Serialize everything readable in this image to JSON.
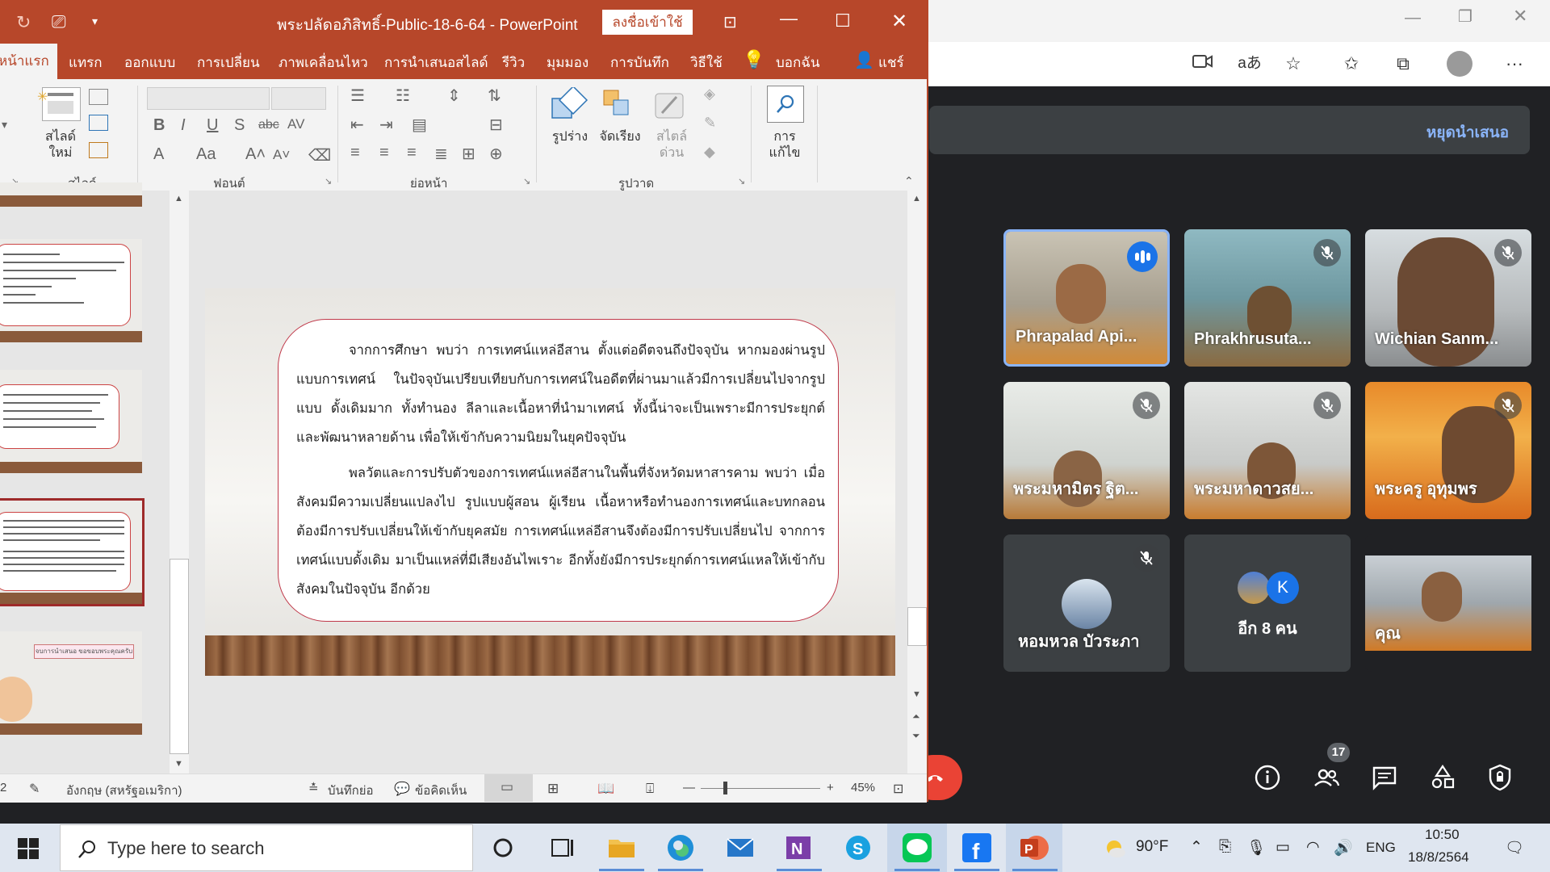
{
  "powerpoint": {
    "title": "พระปลัดอภิสิทธิ์-Public-18-6-64  -  PowerPoint",
    "signin_label": "ลงชื่อเข้าใช้",
    "tabs": [
      "หน้าแรก",
      "แทรก",
      "ออกแบบ",
      "การเปลี่ยน",
      "ภาพเคลื่อนไหว",
      "การนำเสนอสไลด์",
      "รีวิว",
      "มุมมอง",
      "การบันทึก",
      "วิธีใช้",
      "บอกฉัน",
      "แชร์"
    ],
    "ribbon": {
      "new_slide_label": "สไลด์\nใหม่",
      "group_slides": "สไลด์",
      "group_font": "ฟอนต์",
      "group_paragraph": "ย่อหน้า",
      "group_drawing": "รูปวาด",
      "shapes_label": "รูปร่าง",
      "arrange_label": "จัดเรียง",
      "quick_styles_label": "สไตล์\nด่วน",
      "editing_label": "การ\nแก้ไข"
    },
    "slide": {
      "paragraph1": "จากการศึกษา พบว่า การเทศน์แหล่อีสาน ตั้งแต่อดีตจนถึงปัจจุบัน หากมองผ่านรูปแบบการเทศน์ ในปัจจุบันเปรียบเทียบกับการเทศน์ในอดีตที่ผ่านมาแล้วมีการเปลี่ยนไปจากรูปแบบ ดั้งเดิมมาก ทั้งทำนอง ลีลาและเนื้อหาที่นำมาเทศน์ ทั้งนี้น่าจะเป็นเพราะมีการประยุกต์ และพัฒนาหลายด้าน เพื่อให้เข้ากับความนิยมในยุคปัจจุบัน",
      "paragraph2": "พลวัตและการปรับตัวของการเทศน์แหล่อีสานในพื้นที่จังหวัดมหาสารคาม พบว่า เมื่อสังคมมีความเปลี่ยนแปลงไป รูปแบบผู้สอน ผู้เรียน เนื้อหาหรือทำนองการเทศน์และบทกลอน ต้องมีการปรับเปลี่ยนให้เข้ากับยุคสมัย การเทศน์แหล่อีสานจึงต้องมีการปรับเปลี่ยนไป จากการเทศน์แบบดั้งเดิม มาเป็นแหล่ที่มีเสียงอันไพเราะ อีกทั้งยังมีการประยุกต์การเทศน์แหลให้เข้ากับสังคมในปัจจุบัน อีกด้วย"
    },
    "thumb_title": "จบการนำเสนอ ขอขอบพระคุณครับผม",
    "status": {
      "slide_num": "2",
      "language": "อังกฤษ (สหรัฐอเมริกา)",
      "notes": "บันทึกย่อ",
      "comments": "ข้อคิดเห็น",
      "zoom": "45%"
    }
  },
  "meet": {
    "stop_presenting": "หยุดนำเสนอ",
    "participants": [
      {
        "name": "Phrapalad Api...",
        "muted": false,
        "speaking": true
      },
      {
        "name": "Phrakhrusuta...",
        "muted": true
      },
      {
        "name": "Wichian Sanm...",
        "muted": true
      },
      {
        "name": "พระมหามิตร ฐิต...",
        "muted": true
      },
      {
        "name": "พระมหาดาวสย...",
        "muted": true
      },
      {
        "name": "พระครู อุทุมพร",
        "muted": true
      },
      {
        "name": "หอมหวล บัวระภา",
        "muted": true
      },
      {
        "name": "อีก 8 คน",
        "muted": false
      },
      {
        "name": "คุณ",
        "muted": false
      }
    ],
    "others_avatar_letter": "K",
    "participant_count": "17"
  },
  "taskbar": {
    "search_placeholder": "Type here to search",
    "weather": "90°F",
    "language": "ENG",
    "time": "10:50",
    "date": "18/8/2564"
  },
  "colors": {
    "ppt_accent": "#b7472a",
    "meet_bg": "#202124",
    "meet_link": "#8ab4f8",
    "speaking_blue": "#1a73e8"
  }
}
